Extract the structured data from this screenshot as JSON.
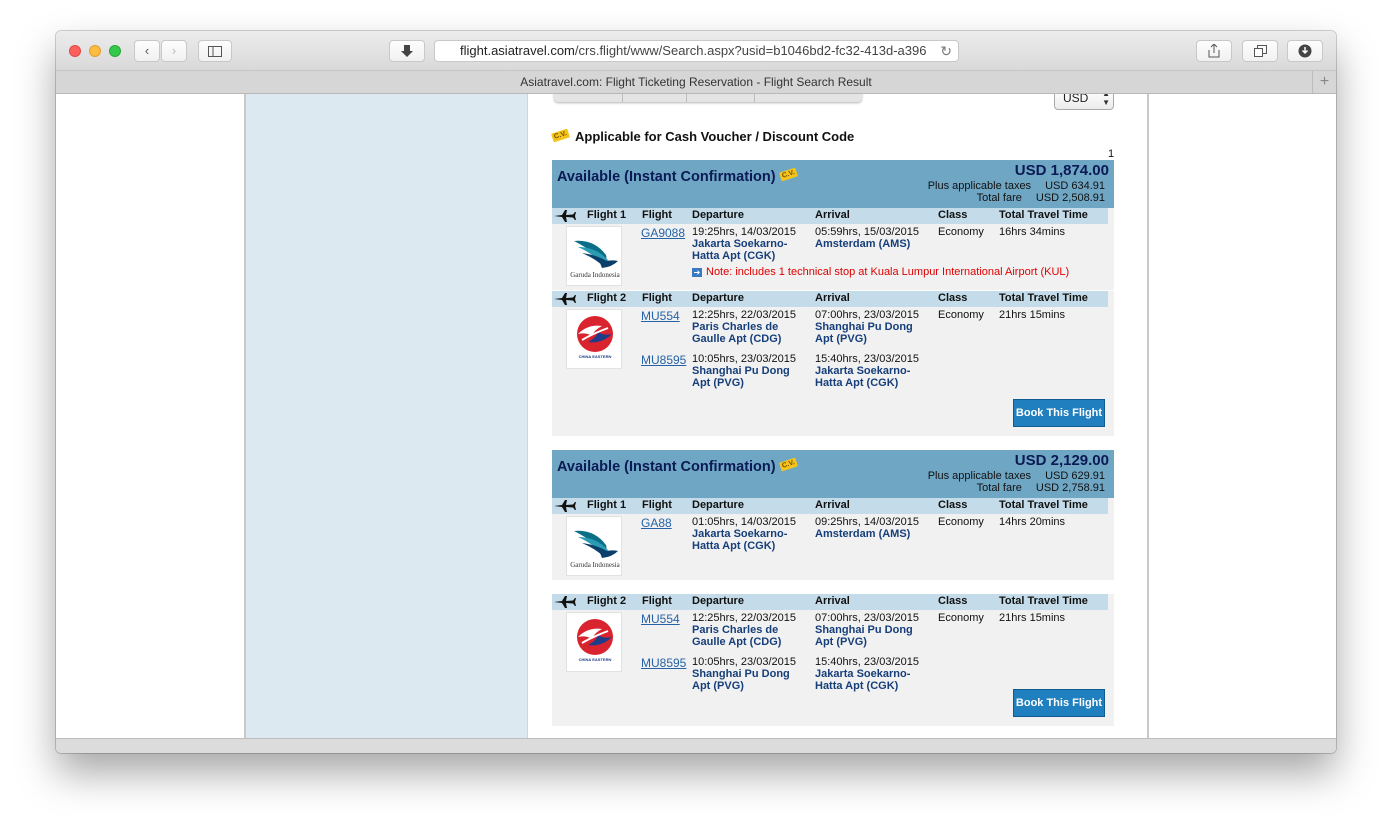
{
  "browser": {
    "url_domain": "flight.asiatravel.com",
    "url_path": "/crs.flight/www/Search.aspx?usid=b1046bd2-fc32-413d-a396",
    "tab_title": "Asiatravel.com: Flight Ticketing Reservation - Flight Search Result"
  },
  "currency": "USD",
  "voucher_text": "Applicable for Cash Voucher / Discount Code",
  "cv_badge": "C.V.",
  "page_number": "1",
  "labels": {
    "flight": "Flight",
    "departure": "Departure",
    "arrival": "Arrival",
    "class": "Class",
    "total_travel_time": "Total Travel Time",
    "plus_taxes": "Plus applicable taxes",
    "total_fare": "Total fare",
    "book": "Book This Flight"
  },
  "results": [
    {
      "status": "Available (Instant Confirmation)",
      "price": "USD 1,874.00",
      "taxes": "USD 634.91",
      "total": "USD 2,508.91",
      "legs": [
        {
          "title": "Flight 1",
          "airline": "Garuda Indonesia",
          "segments": [
            {
              "flight": "GA9088",
              "dep_time": "19:25hrs, 14/03/2015",
              "dep_airport": "Jakarta Soekarno-Hatta Apt (CGK)",
              "arr_time": "05:59hrs, 15/03/2015",
              "arr_airport": "Amsterdam (AMS)",
              "class": "Economy",
              "travel_time": "16hrs 34mins"
            }
          ],
          "note": "Note: includes 1 technical stop at Kuala Lumpur International Airport (KUL)"
        },
        {
          "title": "Flight 2",
          "airline": "CHINA EASTERN",
          "segments": [
            {
              "flight": "MU554",
              "dep_time": "12:25hrs, 22/03/2015",
              "dep_airport": "Paris Charles de Gaulle Apt (CDG)",
              "arr_time": "07:00hrs, 23/03/2015",
              "arr_airport": "Shanghai Pu Dong Apt (PVG)",
              "class": "Economy",
              "travel_time": "21hrs 15mins"
            },
            {
              "flight": "MU8595",
              "dep_time": "10:05hrs, 23/03/2015",
              "dep_airport": "Shanghai Pu Dong Apt (PVG)",
              "arr_time": "15:40hrs, 23/03/2015",
              "arr_airport": "Jakarta Soekarno-Hatta Apt (CGK)"
            }
          ]
        }
      ]
    },
    {
      "status": "Available (Instant Confirmation)",
      "price": "USD 2,129.00",
      "taxes": "USD 629.91",
      "total": "USD 2,758.91",
      "legs": [
        {
          "title": "Flight 1",
          "airline": "Garuda Indonesia",
          "segments": [
            {
              "flight": "GA88",
              "dep_time": "01:05hrs, 14/03/2015",
              "dep_airport": "Jakarta Soekarno-Hatta Apt (CGK)",
              "arr_time": "09:25hrs, 14/03/2015",
              "arr_airport": "Amsterdam (AMS)",
              "class": "Economy",
              "travel_time": "14hrs 20mins"
            }
          ]
        },
        {
          "title": "Flight 2",
          "airline": "CHINA EASTERN",
          "segments": [
            {
              "flight": "MU554",
              "dep_time": "12:25hrs, 22/03/2015",
              "dep_airport": "Paris Charles de Gaulle Apt (CDG)",
              "arr_time": "07:00hrs, 23/03/2015",
              "arr_airport": "Shanghai Pu Dong Apt (PVG)",
              "class": "Economy",
              "travel_time": "21hrs 15mins"
            },
            {
              "flight": "MU8595",
              "dep_time": "10:05hrs, 23/03/2015",
              "dep_airport": "Shanghai Pu Dong Apt (PVG)",
              "arr_time": "15:40hrs, 23/03/2015",
              "arr_airport": "Jakarta Soekarno-Hatta Apt (CGK)"
            }
          ]
        }
      ]
    }
  ]
}
